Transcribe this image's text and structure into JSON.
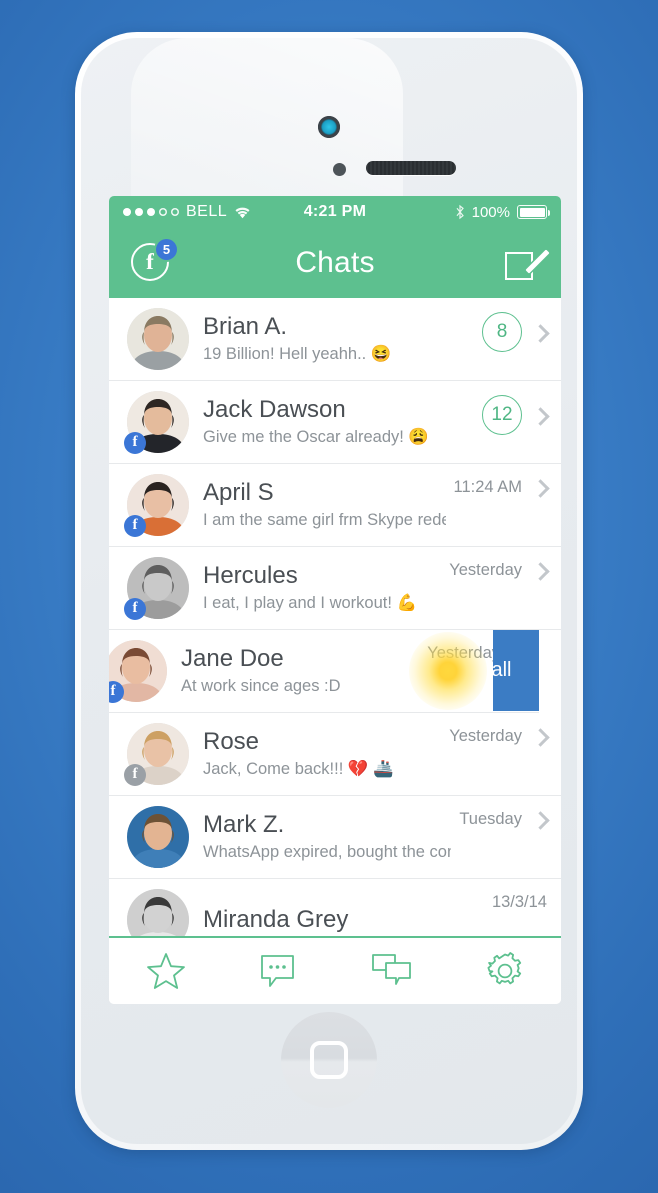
{
  "colors": {
    "background_blue": "#3a7ec7",
    "accent_green": "#5dc08f",
    "badge_blue": "#3b76d6",
    "swipe_blue": "#3b7cc4",
    "text_dark": "#4a4f54",
    "text_muted": "#8d9398"
  },
  "status_bar": {
    "carrier": "BELL",
    "signal_dots_filled": 3,
    "signal_dots_total": 5,
    "wifi_icon": "wifi-icon",
    "time": "4:21 PM",
    "bluetooth_icon": "bluetooth-icon",
    "battery_percent": "100%",
    "battery_level": 100
  },
  "navbar": {
    "title": "Chats",
    "facebook_icon": "facebook-icon",
    "facebook_badge": "5",
    "compose_icon": "compose-icon"
  },
  "chats": [
    {
      "name": "Brian A.",
      "message": "19 Billion! Hell yeahh.. 😆",
      "unread": "8",
      "time": "",
      "facebook": false,
      "facebook_state": "",
      "avatar": "avatar-brian"
    },
    {
      "name": "Jack Dawson",
      "message": "Give me the Oscar already! 😩",
      "unread": "12",
      "time": "",
      "facebook": true,
      "facebook_state": "online",
      "avatar": "avatar-jack"
    },
    {
      "name": "April S",
      "message": "I am the same girl frm Skype redesign!",
      "unread": "",
      "time": "11:24 AM",
      "facebook": true,
      "facebook_state": "online",
      "avatar": "avatar-april"
    },
    {
      "name": "Hercules",
      "message": "I eat, I play and I workout! 💪",
      "unread": "",
      "time": "Yesterday",
      "facebook": true,
      "facebook_state": "online",
      "avatar": "avatar-hercules"
    },
    {
      "name": "Jane Doe",
      "message": "At work since ages :D",
      "unread": "",
      "time": "Yesterday",
      "facebook": true,
      "facebook_state": "online",
      "avatar": "avatar-jane",
      "swiped": true,
      "swipe_action_label": "Call"
    },
    {
      "name": "Rose",
      "message": "Jack, Come back!!! 💔 🚢",
      "unread": "",
      "time": "Yesterday",
      "facebook": true,
      "facebook_state": "offline",
      "avatar": "avatar-rose"
    },
    {
      "name": "Mark Z.",
      "message": "WhatsApp expired, bought the company",
      "unread": "",
      "time": "Tuesday",
      "facebook": false,
      "facebook_state": "",
      "avatar": "avatar-mark"
    },
    {
      "name": "Miranda Grey",
      "message": "",
      "unread": "",
      "time": "13/3/14",
      "facebook": false,
      "facebook_state": "",
      "avatar": "avatar-miranda"
    }
  ],
  "tabbar": {
    "tabs": [
      {
        "name": "favorites",
        "icon": "star-icon"
      },
      {
        "name": "messages",
        "icon": "chat-bubble-dots-icon"
      },
      {
        "name": "chats",
        "icon": "double-chat-bubble-icon"
      },
      {
        "name": "settings",
        "icon": "gear-icon"
      }
    ]
  },
  "device": {
    "camera": "front-camera",
    "sensor": "proximity-sensor",
    "speaker": "earpiece-speaker",
    "home_button": "home-button",
    "buttons": [
      "mute-switch",
      "volume-up-button",
      "volume-down-button",
      "power-button"
    ]
  }
}
